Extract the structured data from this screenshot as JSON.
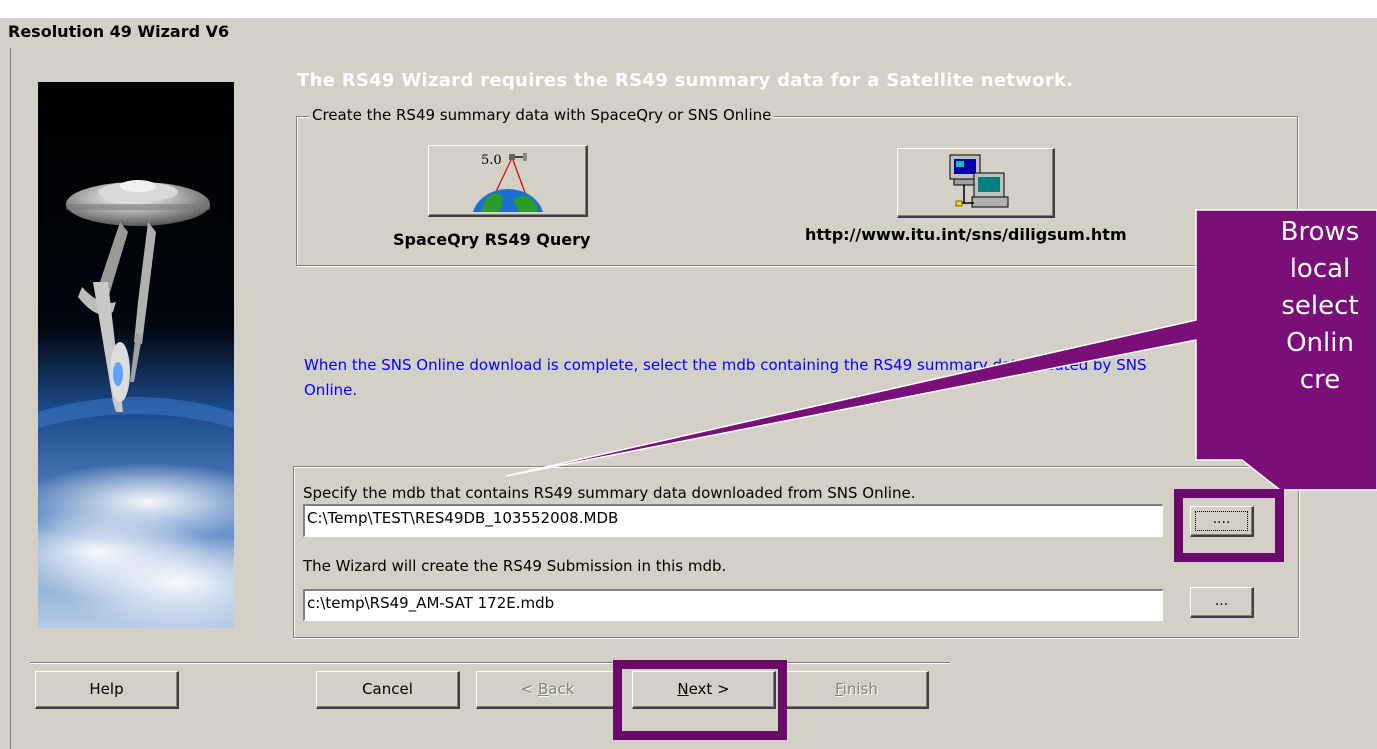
{
  "window": {
    "title": "Resolution 49 Wizard V6"
  },
  "headline": "The RS49 Wizard requires the RS49 summary data for a Satellite network.",
  "create_group": {
    "legend": "Create the RS49 summary data with SpaceQry or SNS Online",
    "spaceqry_version": "5.0",
    "spaceqry_label": "SpaceQry RS49 Query",
    "sns_url": "http://www.itu.int/sns/diligsum.htm"
  },
  "info_text": "When the SNS Online download is complete, select the mdb containing the RS49 summary data created by SNS Online.",
  "mdb_group": {
    "specify_label": "Specify the mdb that contains  RS49 summary data downloaded from SNS Online.",
    "source_value": "C:\\Temp\\TEST\\RES49DB_103552008.MDB",
    "source_browse_label": "....",
    "create_label": "The Wizard will create the  RS49 Submission in this mdb.",
    "target_value": "c:\\temp\\RS49_AM-SAT 172E.mdb",
    "target_browse_label": "..."
  },
  "nav": {
    "help": "Help",
    "cancel": "Cancel",
    "back_arrow": "< ",
    "back_mnemonic": "B",
    "back_rest": "ack",
    "next_mnemonic": "N",
    "next_rest": "ext >",
    "finish_mnemonic": "F",
    "finish_rest": "inish"
  },
  "callout": {
    "lines": [
      "Brows",
      "local",
      "select",
      "Onlin",
      "cre"
    ]
  },
  "colors": {
    "highlight": "#6a0a6a",
    "callout_fill": "#7a0f7a",
    "info_text": "#0000ff"
  }
}
